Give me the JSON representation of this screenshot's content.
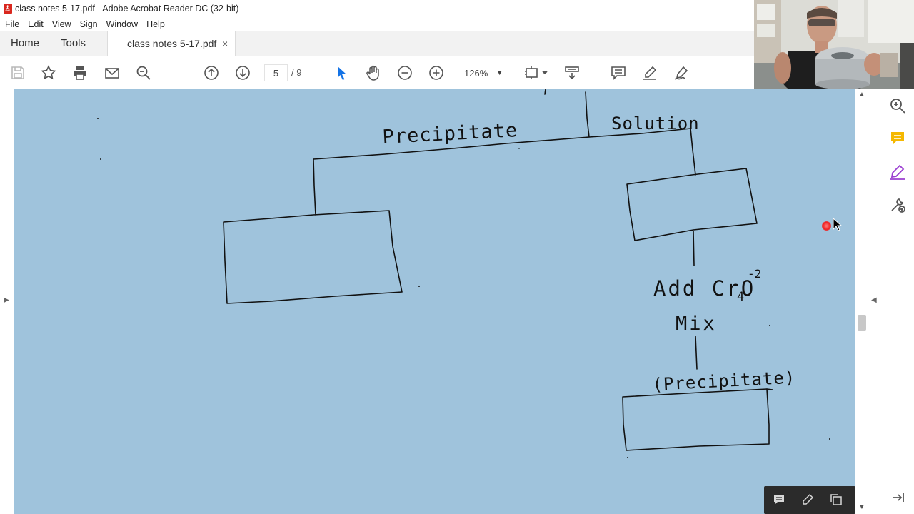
{
  "window": {
    "title": "class notes 5-17.pdf - Adobe Acrobat Reader DC (32-bit)"
  },
  "menu": [
    "File",
    "Edit",
    "View",
    "Sign",
    "Window",
    "Help"
  ],
  "tabs": {
    "home": "Home",
    "tools": "Tools",
    "document": "class notes 5-17.pdf",
    "close": "×"
  },
  "toolbar": {
    "page_current": "5",
    "page_total": "/ 9",
    "zoom": "126%",
    "icons": [
      "save-icon",
      "bookmark-star-icon",
      "print-icon",
      "email-icon",
      "search-icon",
      "page-up-icon",
      "page-down-icon",
      "select-pointer-icon",
      "hand-icon",
      "zoom-out-icon",
      "zoom-in-icon",
      "fit-page-icon",
      "scroll-mode-icon",
      "comment-icon",
      "highlight-pen-icon",
      "sign-icon"
    ]
  },
  "right_tools": [
    "zoom-panel-icon",
    "comment-panel-icon",
    "fill-sign-panel-icon",
    "more-tools-icon",
    "expand-panel-icon"
  ],
  "float_tools": [
    "comment-icon",
    "pen-icon",
    "copy-icon"
  ],
  "diagram": {
    "labels": {
      "precipitate": "Precipitate",
      "solution": "Solution",
      "add": "Add CrO",
      "add_sub": "4",
      "add_sup": "-2",
      "mix": "Mix",
      "precipitate2": "(Precipitate)"
    }
  },
  "colors": {
    "page_background": "#9fc3dc",
    "ink": "#111111",
    "toolbar_icon": "#555555",
    "accent_blue": "#1473e6",
    "accent_yellow": "#f5b800",
    "accent_purple": "#9b3fd1"
  }
}
